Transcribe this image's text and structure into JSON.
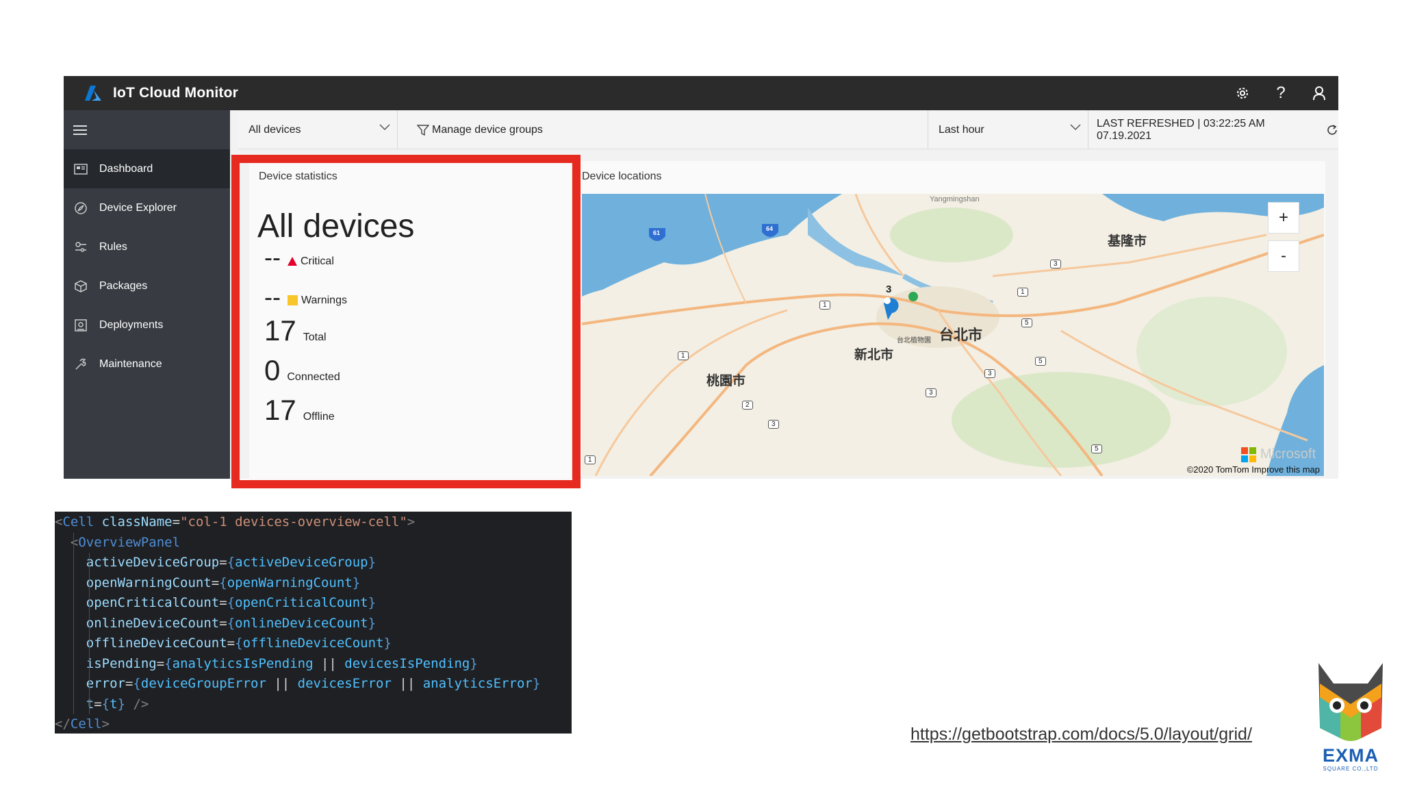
{
  "app": {
    "title": "IoT Cloud Monitor",
    "icons": [
      "gear-icon",
      "help-icon",
      "user-icon"
    ],
    "help_glyph": "?"
  },
  "sidebar": {
    "items": [
      {
        "label": "Dashboard",
        "icon": "dashboard-icon",
        "active": true
      },
      {
        "label": "Device Explorer",
        "icon": "explorer-icon"
      },
      {
        "label": "Rules",
        "icon": "rules-icon"
      },
      {
        "label": "Packages",
        "icon": "package-icon"
      },
      {
        "label": "Deployments",
        "icon": "deployment-icon"
      },
      {
        "label": "Maintenance",
        "icon": "maintenance-icon"
      }
    ]
  },
  "filters": {
    "device_group": "All devices",
    "manage_label": "Manage device groups",
    "time_range": "Last hour",
    "last_refreshed": "LAST REFRESHED | 03:22:25 AM 07.19.2021"
  },
  "stats": {
    "title": "Device statistics",
    "heading": "All devices",
    "critical_value": "--",
    "critical_label": "Critical",
    "warnings_value": "--",
    "warnings_label": "Warnings",
    "total_value": "17",
    "total_label": "Total",
    "connected_value": "0",
    "connected_label": "Connected",
    "offline_value": "17",
    "offline_label": "Offline"
  },
  "map": {
    "title": "Device locations",
    "zoom_in": "+",
    "zoom_out": "-",
    "cluster_count": "3",
    "copyright": "©2020 TomTom Improve this map",
    "brand": "Microsoft",
    "labels": {
      "taipei": "台北市",
      "new_taipei": "新北市",
      "keelung": "基隆市",
      "taoyuan": "桃園市",
      "zoo": "台北植物園",
      "mountain": "Yangmingshan"
    },
    "road_numbers": [
      "61",
      "64",
      "1",
      "1",
      "1",
      "3",
      "5",
      "5",
      "3",
      "3",
      "2",
      "3",
      "1",
      "5"
    ]
  },
  "code": {
    "lines": [
      [
        [
          "tok-punct",
          "<"
        ],
        [
          "tok-tag",
          "Cell"
        ],
        [
          "tok-attr",
          " className"
        ],
        [
          "tok-eq",
          "="
        ],
        [
          "tok-str",
          "\"col-1 devices-overview-cell\""
        ],
        [
          "tok-punct",
          ">"
        ]
      ],
      [
        [
          "tok-op",
          "  "
        ],
        [
          "tok-punct",
          "<"
        ],
        [
          "tok-tag",
          "OverviewPanel"
        ]
      ],
      [
        [
          "tok-op",
          "    "
        ],
        [
          "tok-attr",
          "activeDeviceGroup"
        ],
        [
          "tok-eq",
          "="
        ],
        [
          "tok-brace",
          "{"
        ],
        [
          "tok-var",
          "activeDeviceGroup"
        ],
        [
          "tok-brace",
          "}"
        ]
      ],
      [
        [
          "tok-op",
          "    "
        ],
        [
          "tok-attr",
          "openWarningCount"
        ],
        [
          "tok-eq",
          "="
        ],
        [
          "tok-brace",
          "{"
        ],
        [
          "tok-var",
          "openWarningCount"
        ],
        [
          "tok-brace",
          "}"
        ]
      ],
      [
        [
          "tok-op",
          "    "
        ],
        [
          "tok-attr",
          "openCriticalCount"
        ],
        [
          "tok-eq",
          "="
        ],
        [
          "tok-brace",
          "{"
        ],
        [
          "tok-var",
          "openCriticalCount"
        ],
        [
          "tok-brace",
          "}"
        ]
      ],
      [
        [
          "tok-op",
          "    "
        ],
        [
          "tok-attr",
          "onlineDeviceCount"
        ],
        [
          "tok-eq",
          "="
        ],
        [
          "tok-brace",
          "{"
        ],
        [
          "tok-var",
          "onlineDeviceCount"
        ],
        [
          "tok-brace",
          "}"
        ]
      ],
      [
        [
          "tok-op",
          "    "
        ],
        [
          "tok-attr",
          "offlineDeviceCount"
        ],
        [
          "tok-eq",
          "="
        ],
        [
          "tok-brace",
          "{"
        ],
        [
          "tok-var",
          "offlineDeviceCount"
        ],
        [
          "tok-brace",
          "}"
        ]
      ],
      [
        [
          "tok-op",
          "    "
        ],
        [
          "tok-attr",
          "isPending"
        ],
        [
          "tok-eq",
          "="
        ],
        [
          "tok-brace",
          "{"
        ],
        [
          "tok-var",
          "analyticsIsPending"
        ],
        [
          "tok-op",
          " || "
        ],
        [
          "tok-var",
          "devicesIsPending"
        ],
        [
          "tok-brace",
          "}"
        ]
      ],
      [
        [
          "tok-op",
          "    "
        ],
        [
          "tok-attr",
          "error"
        ],
        [
          "tok-eq",
          "="
        ],
        [
          "tok-brace",
          "{"
        ],
        [
          "tok-var",
          "deviceGroupError"
        ],
        [
          "tok-op",
          " || "
        ],
        [
          "tok-var",
          "devicesError"
        ],
        [
          "tok-op",
          " || "
        ],
        [
          "tok-var",
          "analyticsError"
        ],
        [
          "tok-brace",
          "}"
        ]
      ],
      [
        [
          "tok-op",
          "    "
        ],
        [
          "tok-attr",
          "t"
        ],
        [
          "tok-eq",
          "="
        ],
        [
          "tok-brace",
          "{"
        ],
        [
          "tok-var",
          "t"
        ],
        [
          "tok-brace",
          "}"
        ],
        [
          "tok-punct",
          " />"
        ]
      ],
      [
        [
          "tok-punct",
          "</"
        ],
        [
          "tok-tag",
          "Cell"
        ],
        [
          "tok-punct",
          ">"
        ]
      ]
    ]
  },
  "footer": {
    "link": "https://getbootstrap.com/docs/5.0/layout/grid/",
    "logo_text": "EXMA",
    "logo_subtext": "SQUARE CO.,LTD"
  },
  "colors": {
    "highlight": "#e62a1f",
    "topbar": "#2b2b2b",
    "sidebar": "#383c42",
    "critical": "#e3002c",
    "warning": "#f8c62b",
    "water": "#6fb1dc"
  }
}
